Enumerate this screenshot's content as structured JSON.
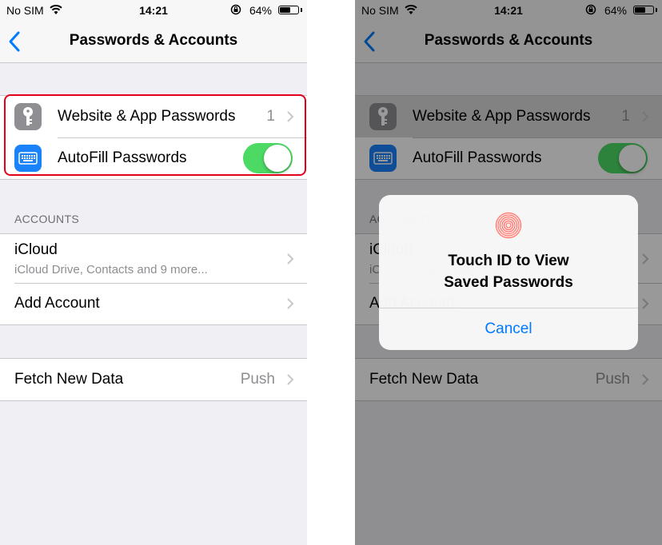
{
  "status_bar": {
    "carrier": "No SIM",
    "time": "14:21",
    "battery_percent": "64%",
    "battery_level": 0.64,
    "icons": [
      "wifi-icon",
      "orientation-lock-icon",
      "battery-icon"
    ]
  },
  "nav": {
    "title": "Passwords & Accounts",
    "back_icon": "chevron-left-icon"
  },
  "passwords_group": {
    "website_passwords": {
      "label": "Website & App Passwords",
      "count": "1",
      "icon": "key-icon",
      "icon_color": "#8e8e93"
    },
    "autofill": {
      "label": "AutoFill Passwords",
      "enabled": true,
      "icon": "keyboard-icon",
      "icon_color": "#1a82fb"
    }
  },
  "accounts": {
    "header": "ACCOUNTS",
    "items": [
      {
        "label": "iCloud",
        "sublabel": "iCloud Drive, Contacts and 9 more..."
      },
      {
        "label": "Add Account"
      }
    ]
  },
  "fetch": {
    "label": "Fetch New Data",
    "value": "Push"
  },
  "alert": {
    "title_line1": "Touch ID to View",
    "title_line2": "Saved Passwords",
    "cancel_label": "Cancel",
    "icon": "fingerprint-icon"
  },
  "colors": {
    "accent": "#007aff",
    "toggle_on": "#4cd964",
    "highlight": "#e3001b",
    "fingerprint": "#ff3b30"
  }
}
